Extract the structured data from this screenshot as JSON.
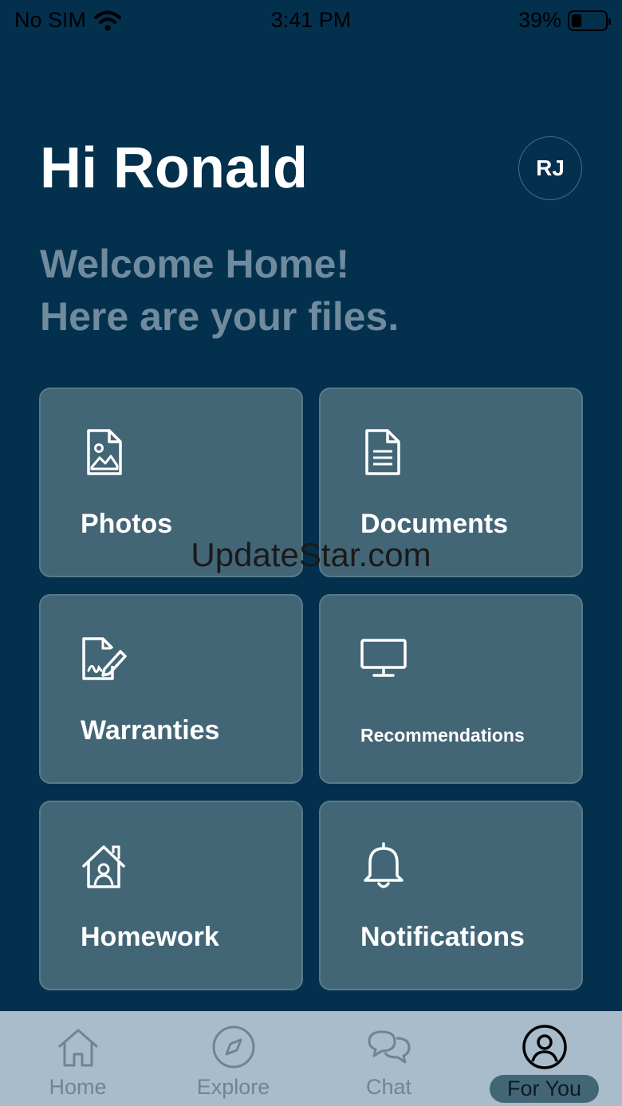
{
  "status_bar": {
    "carrier": "No SIM",
    "time": "3:41 PM",
    "battery": "39%"
  },
  "header": {
    "greeting": "Hi Ronald",
    "avatar_initials": "RJ",
    "welcome_line1": "Welcome Home!",
    "welcome_line2": "Here are your files."
  },
  "cards": [
    {
      "label": "Photos",
      "icon": "photo-file-icon"
    },
    {
      "label": "Documents",
      "icon": "document-icon"
    },
    {
      "label": "Warranties",
      "icon": "signed-document-icon"
    },
    {
      "label": "Recommendations",
      "icon": "monitor-icon"
    },
    {
      "label": "Homework",
      "icon": "home-user-icon"
    },
    {
      "label": "Notifications",
      "icon": "bell-icon"
    }
  ],
  "watermark": "UpdateStar.com",
  "tab_bar": {
    "tabs": [
      {
        "label": "Home",
        "icon": "home-icon"
      },
      {
        "label": "Explore",
        "icon": "compass-icon"
      },
      {
        "label": "Chat",
        "icon": "chat-icon"
      },
      {
        "label": "For You",
        "icon": "user-circle-icon"
      }
    ],
    "active": "For You"
  },
  "colors": {
    "background": "#03304d",
    "card": "#436676",
    "subtitle": "#6f8b9d",
    "tab_bar": "#a8bccc"
  }
}
